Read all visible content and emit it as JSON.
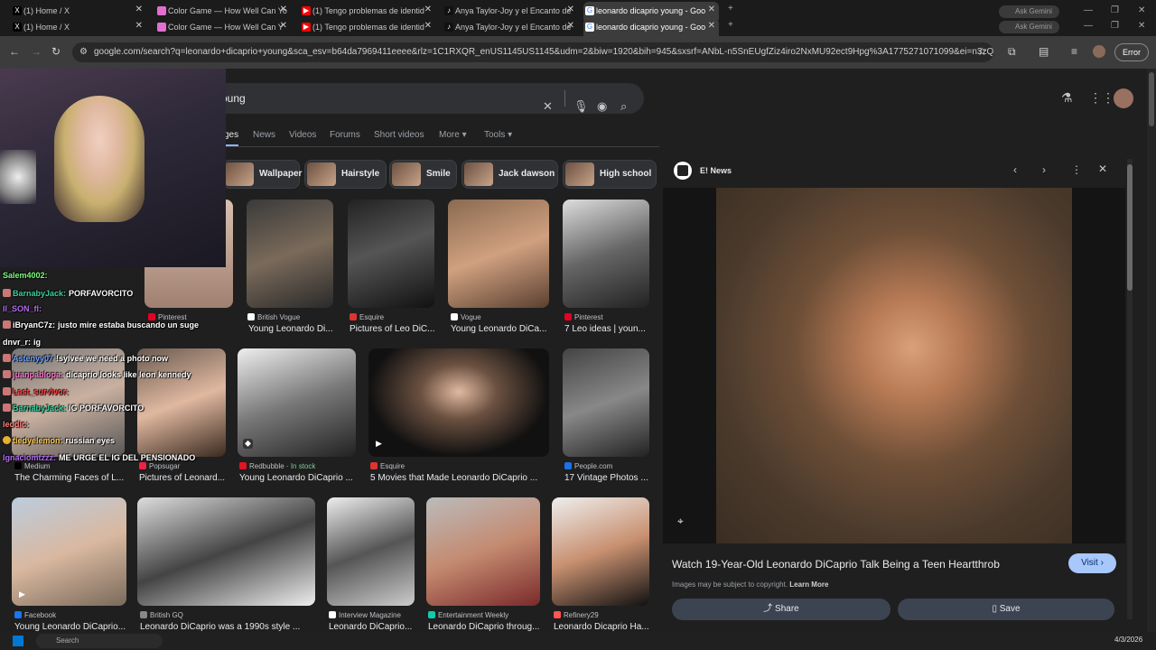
{
  "tabs_row1": [
    {
      "label": "(1) Home / X",
      "fav": "X",
      "color": "#000000"
    },
    {
      "label": "Color Game — How Well Can Yo",
      "fav": "●",
      "color": "#e06fd0"
    },
    {
      "label": "(1) Tengo problemas de identid",
      "fav": "▶",
      "color": "#ff0000"
    },
    {
      "label": "Anya Taylor-Joy y el Encanto de",
      "fav": "♪",
      "color": "#000000"
    },
    {
      "label": "leonardo dicaprio young - Goo",
      "fav": "G",
      "color": "#4285f4"
    }
  ],
  "tabs_row2": [
    {
      "label": "(1) Home / X",
      "fav": "X",
      "color": "#000000"
    },
    {
      "label": "Color Game — How Well Can Y",
      "fav": "●",
      "color": "#e06fd0"
    },
    {
      "label": "(1) Tengo problemas de identid",
      "fav": "▶",
      "color": "#ff0000"
    },
    {
      "label": "Anya Taylor-Joy y el Encanto de",
      "fav": "♪",
      "color": "#000000"
    },
    {
      "label": "leonardo dicaprio young - Goo",
      "fav": "G",
      "color": "#4285f4"
    }
  ],
  "gemini_label": "Ask Gemini",
  "url": "google.com/search?q=leonardo+dicaprio+young&sca_esv=b64da7969411eeee&rlz=1C1RXQR_enUS1145US1145&udm=2&biw=1920&bih=945&sxsrf=ANbL-n5SnEUgfZiz4iro2NxMU92ect9Hpg%3A1775271071099&ei=n3zQaefWBY...",
  "error_label": "Error",
  "search_query": "oung",
  "nav": {
    "images": "ges",
    "news": "News",
    "videos": "Videos",
    "forums": "Forums",
    "short_videos": "Short videos",
    "more": "More",
    "tools": "Tools"
  },
  "chips": [
    "Wallpaper",
    "Hairstyle",
    "Smile",
    "Jack dawson",
    "High school"
  ],
  "row1": [
    {
      "source": "Pinterest",
      "title": ""
    },
    {
      "source": "British Vogue",
      "title": "Young Leonardo Di..."
    },
    {
      "source": "Esquire",
      "title": "Pictures of Leo DiC..."
    },
    {
      "source": "Vogue",
      "title": "Young Leonardo DiCa..."
    },
    {
      "source": "Pinterest",
      "title": "7 Leo ideas | youn..."
    }
  ],
  "row2": [
    {
      "source": "Medium",
      "title": "The Charming Faces of L..."
    },
    {
      "source": "Popsugar",
      "title": "Pictures of Leonard..."
    },
    {
      "source": "Redbubble",
      "stock": "In stock",
      "title": "Young Leonardo DiCaprio ..."
    },
    {
      "source": "Esquire",
      "title": "5 Movies that Made Leonardo DiCaprio ..."
    },
    {
      "source": "People.com",
      "title": "17 Vintage Photos ..."
    }
  ],
  "row3": [
    {
      "source": "Facebook",
      "title": "Young Leonardo DiCaprio..."
    },
    {
      "source": "British GQ",
      "title": "Leonardo DiCaprio was a 1990s style ..."
    },
    {
      "source": "Interview Magazine",
      "title": "Leonardo DiCaprio..."
    },
    {
      "source": "Entertainment Weekly",
      "title": "Leonardo DiCaprio throug..."
    },
    {
      "source": "Refinery29",
      "title": "Leonardo Dicaprio Ha..."
    }
  ],
  "panel": {
    "source": "E! News",
    "caption": "Watch 19-Year-Old Leonardo DiCaprio Talk Being a Teen Heartthrob",
    "copyright": "Images may be subject to copyright.",
    "learn_more": "Learn More",
    "visit": "Visit",
    "share": "Share",
    "save": "Save"
  },
  "chat": [
    {
      "user": "Salem4002:",
      "msg": "",
      "color": "#7cfc7c"
    },
    {
      "user": "BarnabyJack:",
      "msg": "PORFAVORCITO",
      "color": "#38d0a0"
    },
    {
      "user": "Il_SON_fl:",
      "msg": "",
      "color": "#b46cf0"
    },
    {
      "user": "iBryanC7z:",
      "msg": "justo mire estaba buscando un suge",
      "color": "#fff"
    },
    {
      "user": "dnvr_r:",
      "msg": "ig",
      "color": "#fff"
    },
    {
      "user": "Astenyy07",
      "msg": "!sylvee we need a photo now",
      "color": "#6aa0ff"
    },
    {
      "user": "juanpablopa:",
      "msg": "dicaprio looks like leon kennedy",
      "color": "#ff7bd0"
    },
    {
      "user": "Last_survivor:",
      "msg": "",
      "color": "#ff4040"
    },
    {
      "user": "BarnabyJack:",
      "msg": "IG PORFAVORCITO",
      "color": "#38d0a0"
    },
    {
      "user": "leodic:",
      "msg": "",
      "color": "#ff8080"
    },
    {
      "user": "tiedyelemon:",
      "msg": "russian eyes",
      "color": "#ffcc55"
    },
    {
      "user": "Ignaciomtzzz:",
      "msg": "ME URGE EL IG DEL PENSIONADO",
      "color": "#b46cf0"
    }
  ],
  "taskbar": {
    "search": "Search",
    "date": "4/3/2026"
  }
}
